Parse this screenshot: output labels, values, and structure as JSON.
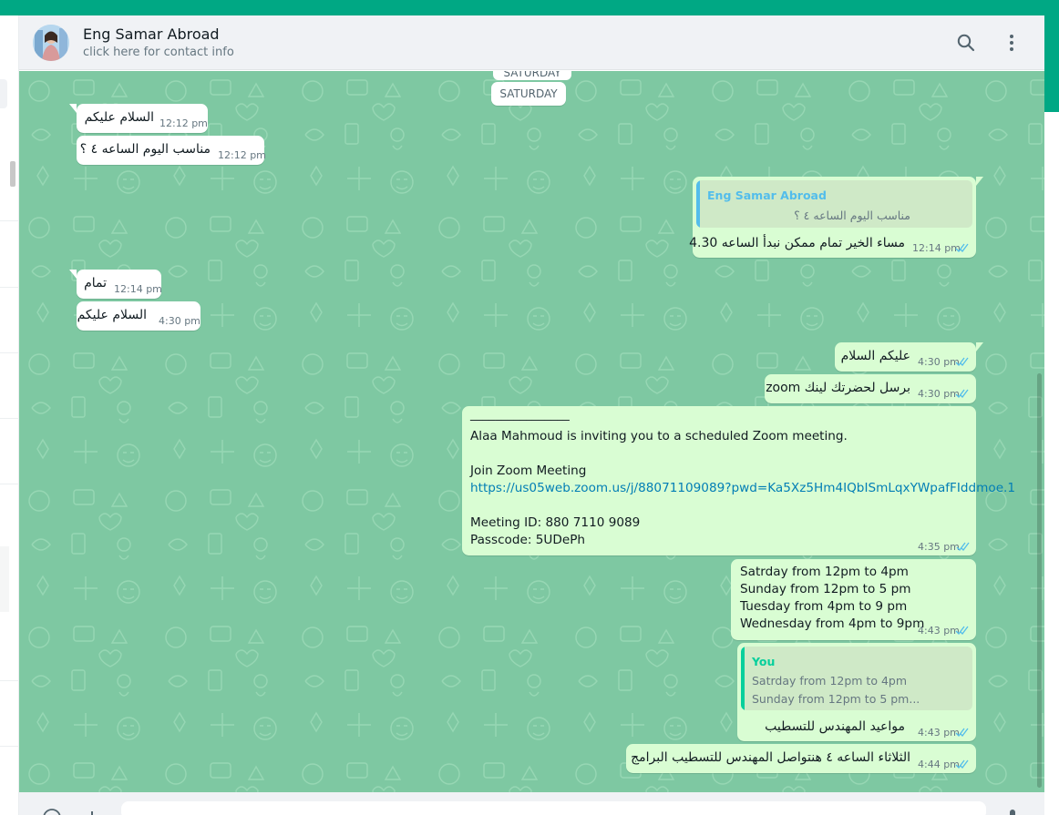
{
  "header": {
    "contact_name": "Eng Samar Abroad",
    "contact_subtitle": "click here for contact info",
    "icons": [
      "search-icon",
      "menu-dots-icon"
    ]
  },
  "chat": {
    "day_label_ghost": "SATURDAY",
    "day_label": "SATURDAY",
    "messages": [
      {
        "dir": "in",
        "text": "السلام عليكم",
        "time": "12:12 pm"
      },
      {
        "dir": "in",
        "text": "مناسب اليوم الساعه ٤ ؟",
        "time": "12:12 pm"
      },
      {
        "dir": "out",
        "quote_author": "Eng Samar Abroad",
        "quote_text": "مناسب اليوم الساعه ٤ ؟",
        "text": "مساء الخير تمام ممكن نبدأ الساعه 4.30",
        "time": "12:14 pm"
      },
      {
        "dir": "in",
        "text": "تمام",
        "time": "12:14 pm"
      },
      {
        "dir": "in",
        "text": "السلام عليكم",
        "time": "4:30 pm"
      },
      {
        "dir": "out",
        "text": "عليكم السلام",
        "time": "4:30 pm"
      },
      {
        "dir": "out",
        "text": "برسل لحضرتك لينك zoom",
        "time": "4:30 pm"
      },
      {
        "dir": "out",
        "lines": [
          "________________",
          "Alaa Mahmoud is inviting you to a scheduled Zoom meeting.",
          "",
          "Join Zoom Meeting",
          "https://us05web.zoom.us/j/88071109089?pwd=Ka5Xz5Hm4IQbISmLqxYWpafFIddmoe.1",
          "",
          "Meeting ID: 880 7110 9089",
          "Passcode: 5UDePh"
        ],
        "time": "4:35 pm"
      },
      {
        "dir": "out",
        "lines": [
          "Satrday from 12pm to 4pm",
          "Sunday from 12pm to 5 pm",
          "Tuesday from 4pm to 9 pm",
          "Wednesday from 4pm to 9pm"
        ],
        "time": "4:43 pm"
      },
      {
        "dir": "out",
        "quote_author": "You",
        "quote_lines": [
          "Satrday from 12pm to 4pm",
          "Sunday from 12pm to 5 pm..."
        ],
        "text": "مواعيد المهندس للتسطيب",
        "time": "4:43 pm"
      },
      {
        "dir": "out",
        "text": "الثلاثاء الساعه ٤ هنتواصل المهندس للتسطيب البرامج",
        "time": "4:44 pm"
      }
    ]
  },
  "colors": {
    "accent": "#00a884",
    "chat_bg": "#7ec8a2",
    "incoming_bubble": "#ffffff",
    "outgoing_bubble": "#d9fdd3",
    "link": "#027eb5",
    "tick_read": "#53bdeb",
    "quote_name_contact": "#53bdeb",
    "quote_name_you": "#06cf9c"
  }
}
